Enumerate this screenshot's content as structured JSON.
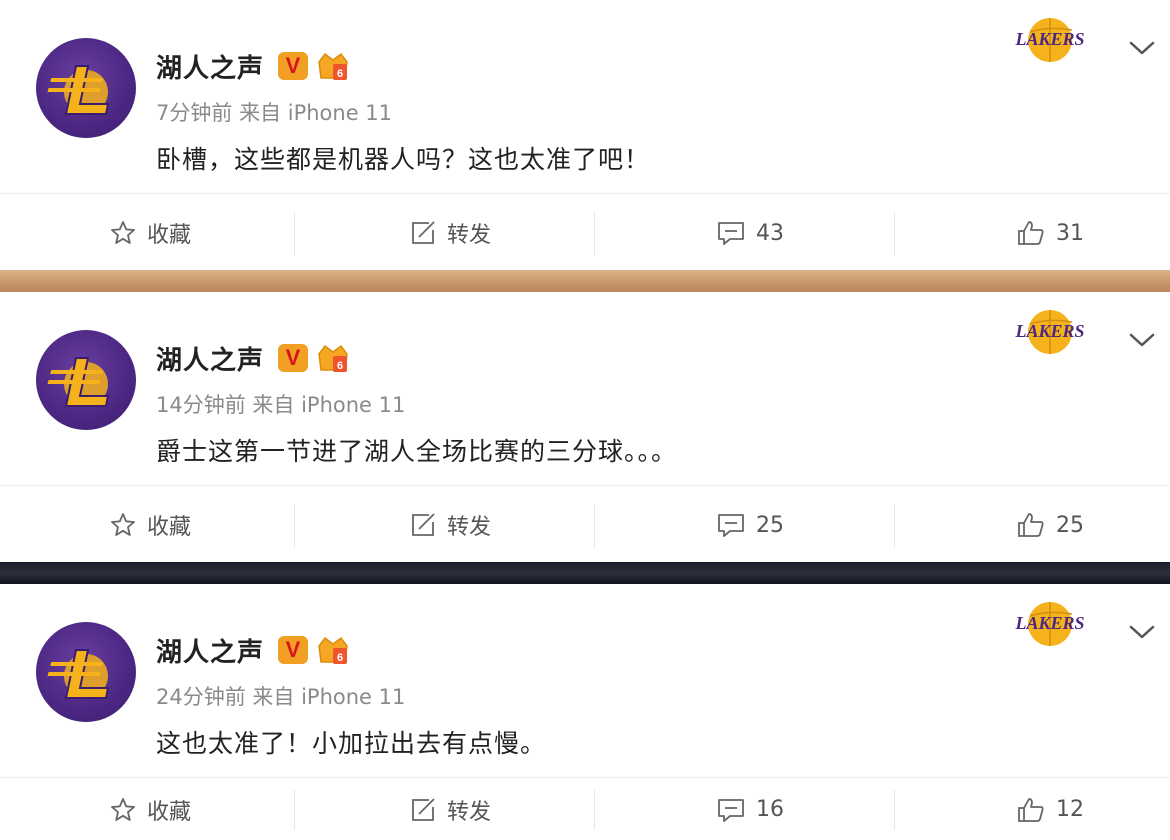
{
  "posts": [
    {
      "author": "湖人之声",
      "verified_badge": "V",
      "time": "7分钟前",
      "source": "来自 iPhone 11",
      "content": "卧槽，这些都是机器人吗？这也太准了吧！",
      "actions": {
        "favorite": "收藏",
        "repost": "转发",
        "comments": "43",
        "likes": "31"
      }
    },
    {
      "author": "湖人之声",
      "verified_badge": "V",
      "time": "14分钟前",
      "source": "来自 iPhone 11",
      "content": "爵士这第一节进了湖人全场比赛的三分球。。。",
      "actions": {
        "favorite": "收藏",
        "repost": "转发",
        "comments": "25",
        "likes": "25"
      }
    },
    {
      "author": "湖人之声",
      "verified_badge": "V",
      "time": "24分钟前",
      "source": "来自 iPhone 11",
      "content": "这也太准了！小加拉出去有点慢。",
      "actions": {
        "favorite": "收藏",
        "repost": "转发",
        "comments": "16",
        "likes": "12"
      }
    }
  ],
  "logo_text": "LAKERS",
  "colors": {
    "lakers_purple": "#4b2783",
    "lakers_gold": "#f5b21b",
    "verified_orange": "#f2a024",
    "verified_red": "#d6161b"
  },
  "icons": [
    "star-icon",
    "repost-icon",
    "comment-icon",
    "thumbs-up-icon",
    "chevron-down-icon",
    "crown-badge-icon"
  ]
}
